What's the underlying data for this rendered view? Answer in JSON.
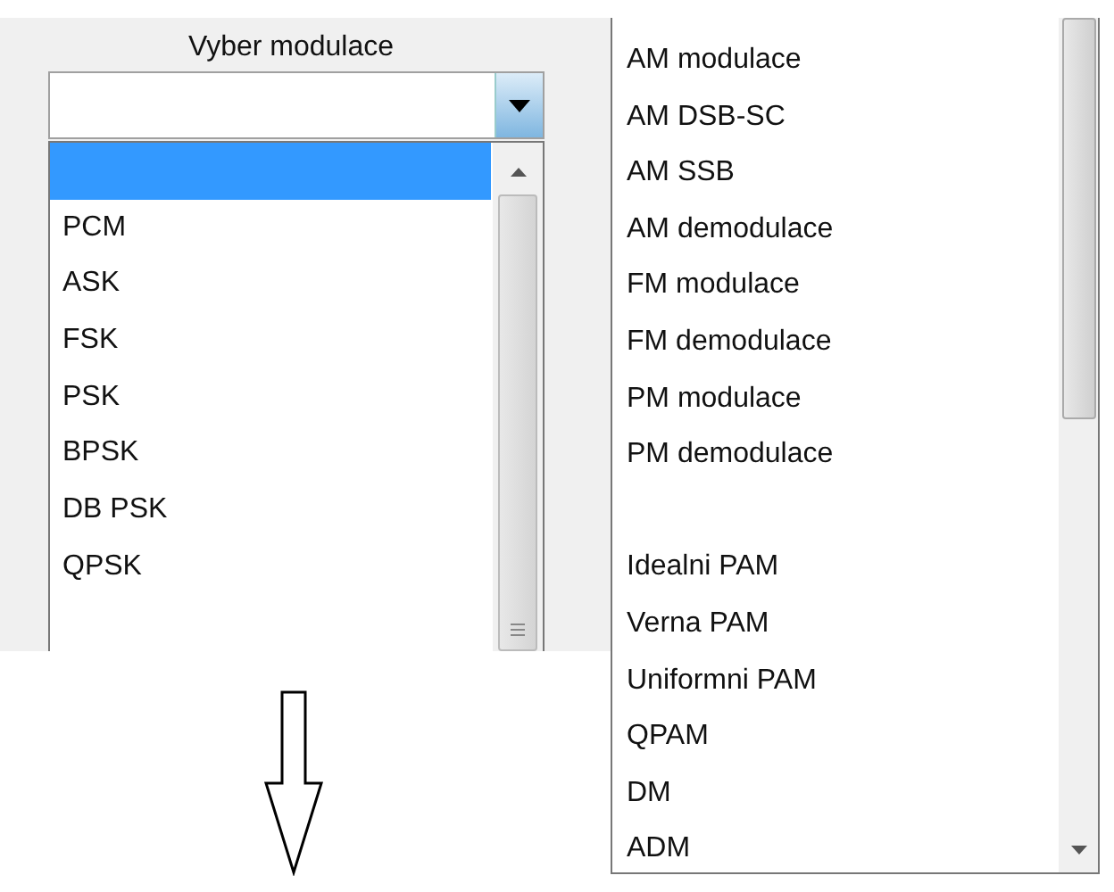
{
  "modulation_picker": {
    "label": "Vyber modulace",
    "options": [
      {
        "selected": true
      },
      {
        "label": "PCM",
        "selected": false
      },
      {
        "label": "ASK",
        "selected": false
      },
      {
        "label": "FSK",
        "selected": false
      },
      {
        "label": "PSK",
        "selected": false
      },
      {
        "label": "BPSK",
        "selected": false
      },
      {
        "label": "DB PSK",
        "selected": false
      },
      {
        "label": "QPSK",
        "selected": false
      }
    ]
  },
  "modulation_list": {
    "items": [
      {
        "kind": "item",
        "label": "AM modulace",
        "selected": false
      },
      {
        "kind": "item",
        "label": "AM DSB-SC",
        "selected": false
      },
      {
        "kind": "item",
        "label": "AM SSB",
        "selected": false
      },
      {
        "kind": "item",
        "label": "AM demodulace",
        "selected": false
      },
      {
        "kind": "item",
        "label": "FM modulace",
        "selected": false
      },
      {
        "kind": "item",
        "label": "FM demodulace",
        "selected": false
      },
      {
        "kind": "item",
        "label": "PM modulace",
        "selected": false
      },
      {
        "kind": "item",
        "label": "PM demodulace",
        "selected": false
      },
      {
        "kind": "gap"
      },
      {
        "kind": "item",
        "label": "Idealni PAM",
        "selected": false
      },
      {
        "kind": "item",
        "label": "Verna PAM",
        "selected": false
      },
      {
        "kind": "item",
        "label": "Uniformni PAM",
        "selected": false
      },
      {
        "kind": "item",
        "label": "QPAM",
        "selected": false
      },
      {
        "kind": "item",
        "label": "DM",
        "selected": false
      },
      {
        "kind": "item",
        "label": "ADM",
        "selected": false
      }
    ]
  }
}
